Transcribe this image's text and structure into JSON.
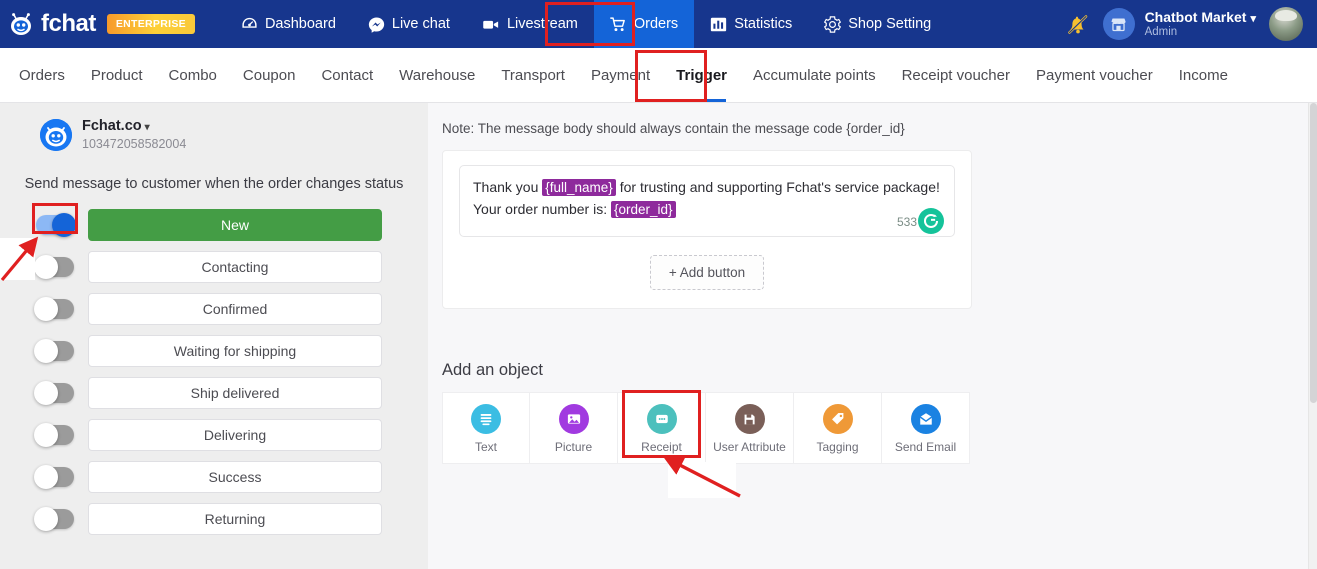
{
  "topnav": {
    "brand": "fchat",
    "brand_icon": "robot-logo-icon",
    "badge": "ENTERPRISE",
    "items": [
      {
        "label": "Dashboard",
        "icon": "dashboard-icon",
        "active": false
      },
      {
        "label": "Live chat",
        "icon": "messenger-icon",
        "active": false
      },
      {
        "label": "Livestream",
        "icon": "video-camera-icon",
        "active": false
      },
      {
        "label": "Orders",
        "icon": "shopping-cart-icon",
        "active": true
      },
      {
        "label": "Statistics",
        "icon": "bar-chart-icon",
        "active": false
      },
      {
        "label": "Shop Setting",
        "icon": "gear-icon",
        "active": false
      }
    ],
    "notification_icon": "bell-slash-icon",
    "shop_icon": "shop-icon",
    "user_name": "Chatbot Market",
    "user_role": "Admin",
    "user_caret": "▾",
    "avatar_icon": "user-avatar"
  },
  "subnav": {
    "items": [
      {
        "label": "Orders",
        "active": false
      },
      {
        "label": "Product",
        "active": false
      },
      {
        "label": "Combo",
        "active": false
      },
      {
        "label": "Coupon",
        "active": false
      },
      {
        "label": "Contact",
        "active": false
      },
      {
        "label": "Warehouse",
        "active": false
      },
      {
        "label": "Transport",
        "active": false
      },
      {
        "label": "Payment",
        "active": false
      },
      {
        "label": "Trigger",
        "active": true
      },
      {
        "label": "Accumulate points",
        "active": false
      },
      {
        "label": "Receipt voucher",
        "active": false
      },
      {
        "label": "Payment voucher",
        "active": false
      },
      {
        "label": "Income",
        "active": false
      }
    ]
  },
  "sidebar": {
    "page_name": "Fchat.co",
    "page_caret": "▾",
    "page_id": "103472058582004",
    "hint": "Send message to customer when the order changes status",
    "statuses": [
      {
        "label": "New",
        "toggle_on": true,
        "selected": true
      },
      {
        "label": "Contacting",
        "toggle_on": false,
        "selected": false
      },
      {
        "label": "Confirmed",
        "toggle_on": false,
        "selected": false
      },
      {
        "label": "Waiting for shipping",
        "toggle_on": false,
        "selected": false
      },
      {
        "label": "Ship delivered",
        "toggle_on": false,
        "selected": false
      },
      {
        "label": "Delivering",
        "toggle_on": false,
        "selected": false
      },
      {
        "label": "Success",
        "toggle_on": false,
        "selected": false
      },
      {
        "label": "Returning",
        "toggle_on": false,
        "selected": false
      }
    ]
  },
  "main": {
    "note": "Note: The message body should always contain the message code {order_id}",
    "message": {
      "line1_pre": "Thank you ",
      "var1": "{full_name}",
      "line1_post": " for trusting and supporting Fchat's service package!",
      "line2_pre": "Your order number is: ",
      "var2": "{order_id}",
      "counter": "533",
      "counter_icon": "grammarly-icon"
    },
    "add_button_label": "+ Add button",
    "section_title": "Add an object",
    "objects": [
      {
        "label": "Text",
        "icon": "text-lines-icon",
        "color": "#3bbde3",
        "highlighted": false
      },
      {
        "label": "Picture",
        "icon": "image-icon",
        "color": "#a13ae0",
        "highlighted": false
      },
      {
        "label": "Receipt",
        "icon": "chat-bubble-icon",
        "color": "#4cc0bd",
        "highlighted": true
      },
      {
        "label": "User Attribute",
        "icon": "floppy-save-icon",
        "color": "#7a5f58",
        "highlighted": false
      },
      {
        "label": "Tagging",
        "icon": "tag-icon",
        "color": "#ef9937",
        "highlighted": false
      },
      {
        "label": "Send Email",
        "icon": "envelope-icon",
        "color": "#1a82e2",
        "highlighted": false
      }
    ]
  },
  "annotations": {
    "highlight_color": "#e02020",
    "targets": [
      "orders-nav-item",
      "trigger-subnav-item",
      "new-status-toggle",
      "receipt-object-cell"
    ]
  }
}
